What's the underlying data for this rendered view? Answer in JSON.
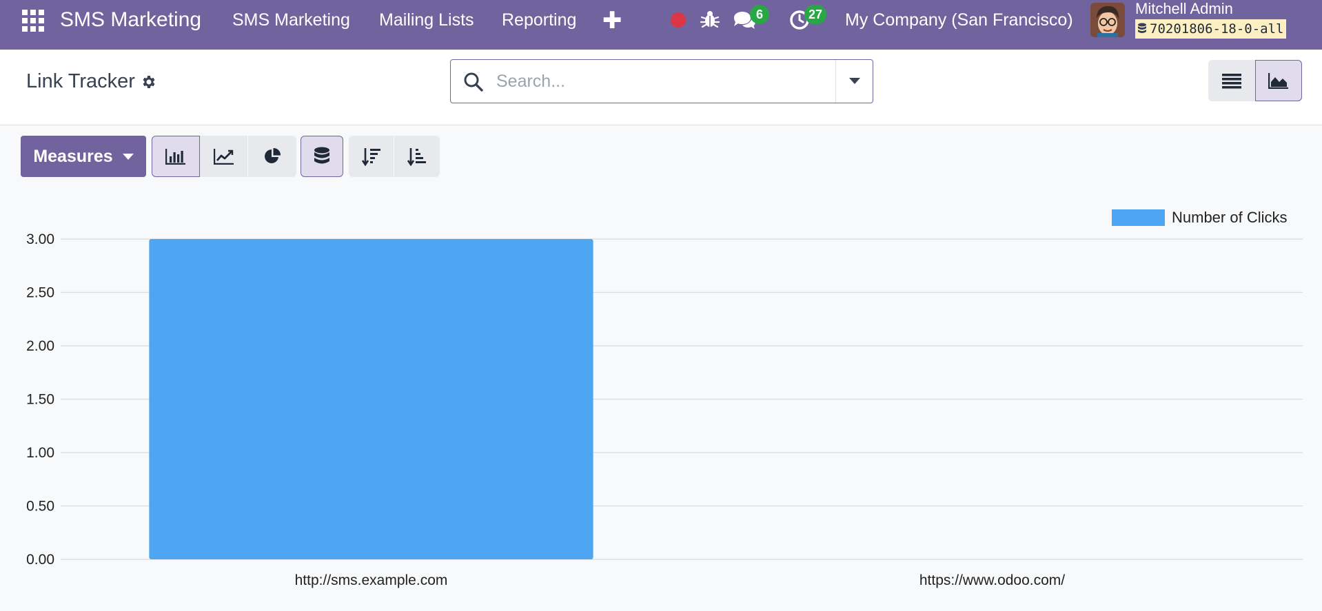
{
  "navbar": {
    "brand": "SMS Marketing",
    "menus": [
      {
        "label": "SMS Marketing"
      },
      {
        "label": "Mailing Lists"
      },
      {
        "label": "Reporting"
      }
    ],
    "messages_count": "6",
    "activities_count": "27",
    "company": "My Company (San Francisco)",
    "user_name": "Mitchell Admin",
    "db_name": "70201806-18-0-all",
    "accent": "#71639e",
    "recording_color": "#dc3545",
    "badge_color": "#28a745"
  },
  "control_panel": {
    "title": "Link Tracker",
    "search_placeholder": "Search...",
    "views": [
      "list",
      "graph"
    ],
    "active_view": "graph"
  },
  "toolbar": {
    "measures_label": "Measures",
    "chart_types": [
      "bar",
      "line",
      "pie"
    ],
    "active_chart_type": "bar",
    "stacked": true,
    "sort_options": [
      "descending",
      "ascending"
    ]
  },
  "chart_data": {
    "type": "bar",
    "categories": [
      "http://sms.example.com",
      "https://www.odoo.com/"
    ],
    "series": [
      {
        "name": "Number of Clicks",
        "values": [
          3,
          0
        ],
        "color": "#4ea6f2"
      }
    ],
    "yticks": [
      "0.00",
      "0.50",
      "1.00",
      "1.50",
      "2.00",
      "2.50",
      "3.00"
    ],
    "ylim": [
      0,
      3
    ],
    "grid": true,
    "legend": "top-right"
  }
}
